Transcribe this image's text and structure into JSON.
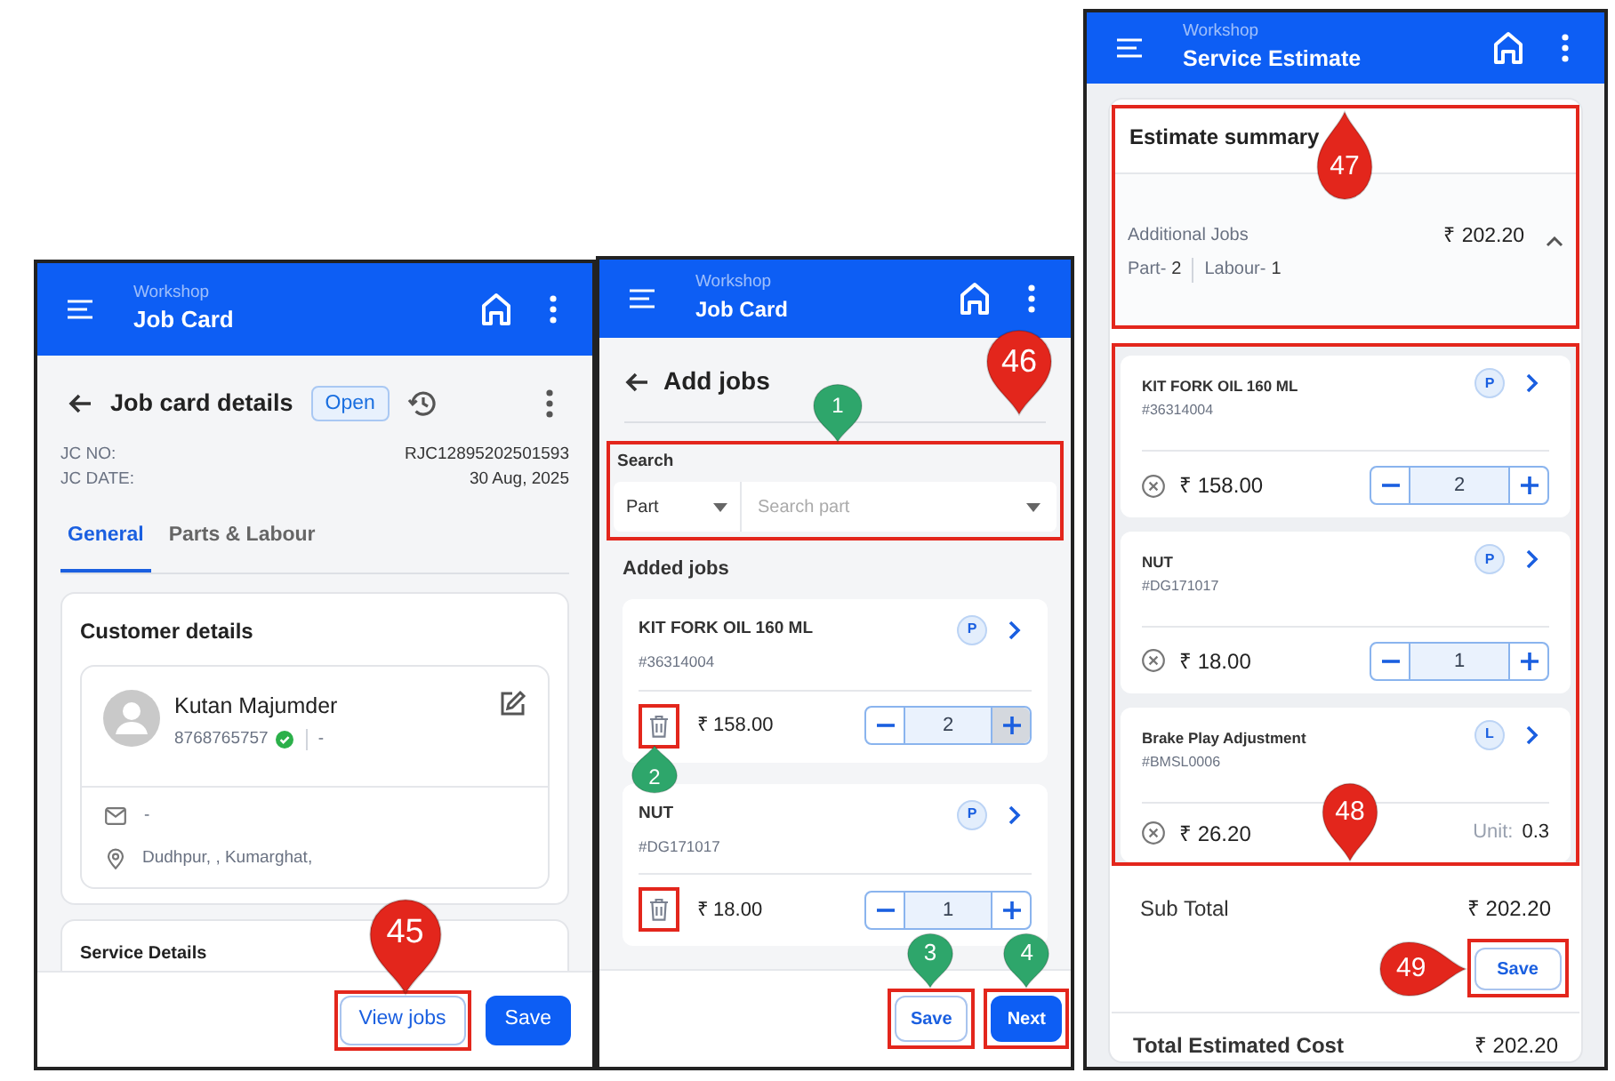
{
  "job_card_screen": {
    "header": {
      "section": "Workshop",
      "title": "Job Card"
    },
    "page_title": "Job card details",
    "status": "Open",
    "fields": [
      {
        "label": "JC NO:",
        "value": "RJC12895202501593"
      },
      {
        "label": "JC DATE:",
        "value": "30 Aug, 2025"
      }
    ],
    "tabs": [
      {
        "label": "General",
        "selected": true
      },
      {
        "label": "Parts & Labour",
        "selected": false
      }
    ],
    "customer": {
      "heading": "Customer details",
      "name": "Kutan Majumder",
      "phone": "8768765757",
      "verified": true,
      "phone_extra": "-",
      "email": "-",
      "address": "Dudhpur, , Kumarghat,"
    },
    "next_section": "Service Details",
    "buttons": [
      {
        "label": "View jobs",
        "kind": "outline",
        "highlighted": true,
        "marker": {
          "label": "45",
          "color": "#e3261c",
          "kind": "down"
        }
      },
      {
        "label": "Save",
        "kind": "filled"
      }
    ]
  },
  "add_jobs_screen": {
    "header": {
      "section": "Workshop",
      "title": "Job Card"
    },
    "marker": {
      "label": "46",
      "color": "#e3261c",
      "kind": "down"
    },
    "page_title": "Add jobs",
    "search": {
      "label": "Search",
      "type": "Part",
      "placeholder": "Search part",
      "highlighted": true,
      "marker": {
        "label": "1",
        "color": "#2ea66b",
        "kind": "down"
      }
    },
    "list_heading": "Added jobs",
    "jobs": [
      {
        "name": "KIT FORK OIL 160 ML",
        "code": "#36314004",
        "badge": "P",
        "price": "₹ 158.00",
        "quantity": "2",
        "delete_highlighted": true,
        "marker": {
          "label": "2",
          "color": "#2ea66b",
          "kind": "up"
        }
      },
      {
        "name": "NUT",
        "code": "#DG171017",
        "badge": "P",
        "price": "₹ 18.00",
        "quantity": "1",
        "delete_highlighted": true
      }
    ],
    "buttons": [
      {
        "label": "Save",
        "kind": "outline",
        "highlighted": true,
        "marker": {
          "label": "3",
          "color": "#2ea66b",
          "kind": "down"
        }
      },
      {
        "label": "Next",
        "kind": "filled",
        "highlighted": true,
        "marker": {
          "label": "4",
          "color": "#2ea66b",
          "kind": "down"
        }
      }
    ]
  },
  "estimate_screen": {
    "header": {
      "section": "Workshop",
      "title": "Service Estimate"
    },
    "summary": {
      "heading": "Estimate summary",
      "highlighted": true,
      "marker": {
        "label": "47",
        "color": "#e3261c",
        "kind": "up"
      },
      "label": "Additional Jobs",
      "amount": "₹ 202.20",
      "part_label": "Part-",
      "part_count": "2",
      "labour_label": "Labour-",
      "labour_count": "1",
      "expanded": true
    },
    "jobs_highlighted": true,
    "jobs_marker": {
      "label": "48",
      "color": "#e3261c",
      "kind": "down"
    },
    "jobs": [
      {
        "kind": "part",
        "name": "KIT FORK OIL 160 ML",
        "code": "#36314004",
        "badge": "P",
        "price": "₹ 158.00",
        "quantity": "2"
      },
      {
        "kind": "part",
        "name": "NUT",
        "code": "#DG171017",
        "badge": "P",
        "price": "₹ 18.00",
        "quantity": "1"
      },
      {
        "kind": "labour",
        "name": "Brake Play Adjustment",
        "code": "#BMSL0006",
        "badge": "L",
        "price": "₹ 26.20",
        "unit_label": "Unit:",
        "unit": "0.3"
      }
    ],
    "sub_total_label": "Sub Total",
    "sub_total": "₹ 202.20",
    "save_button": {
      "label": "Save",
      "highlighted": true,
      "marker": {
        "label": "49",
        "color": "#e3261c",
        "kind": "right"
      }
    },
    "total_label": "Total Estimated Cost",
    "total": "₹ 202.20"
  }
}
